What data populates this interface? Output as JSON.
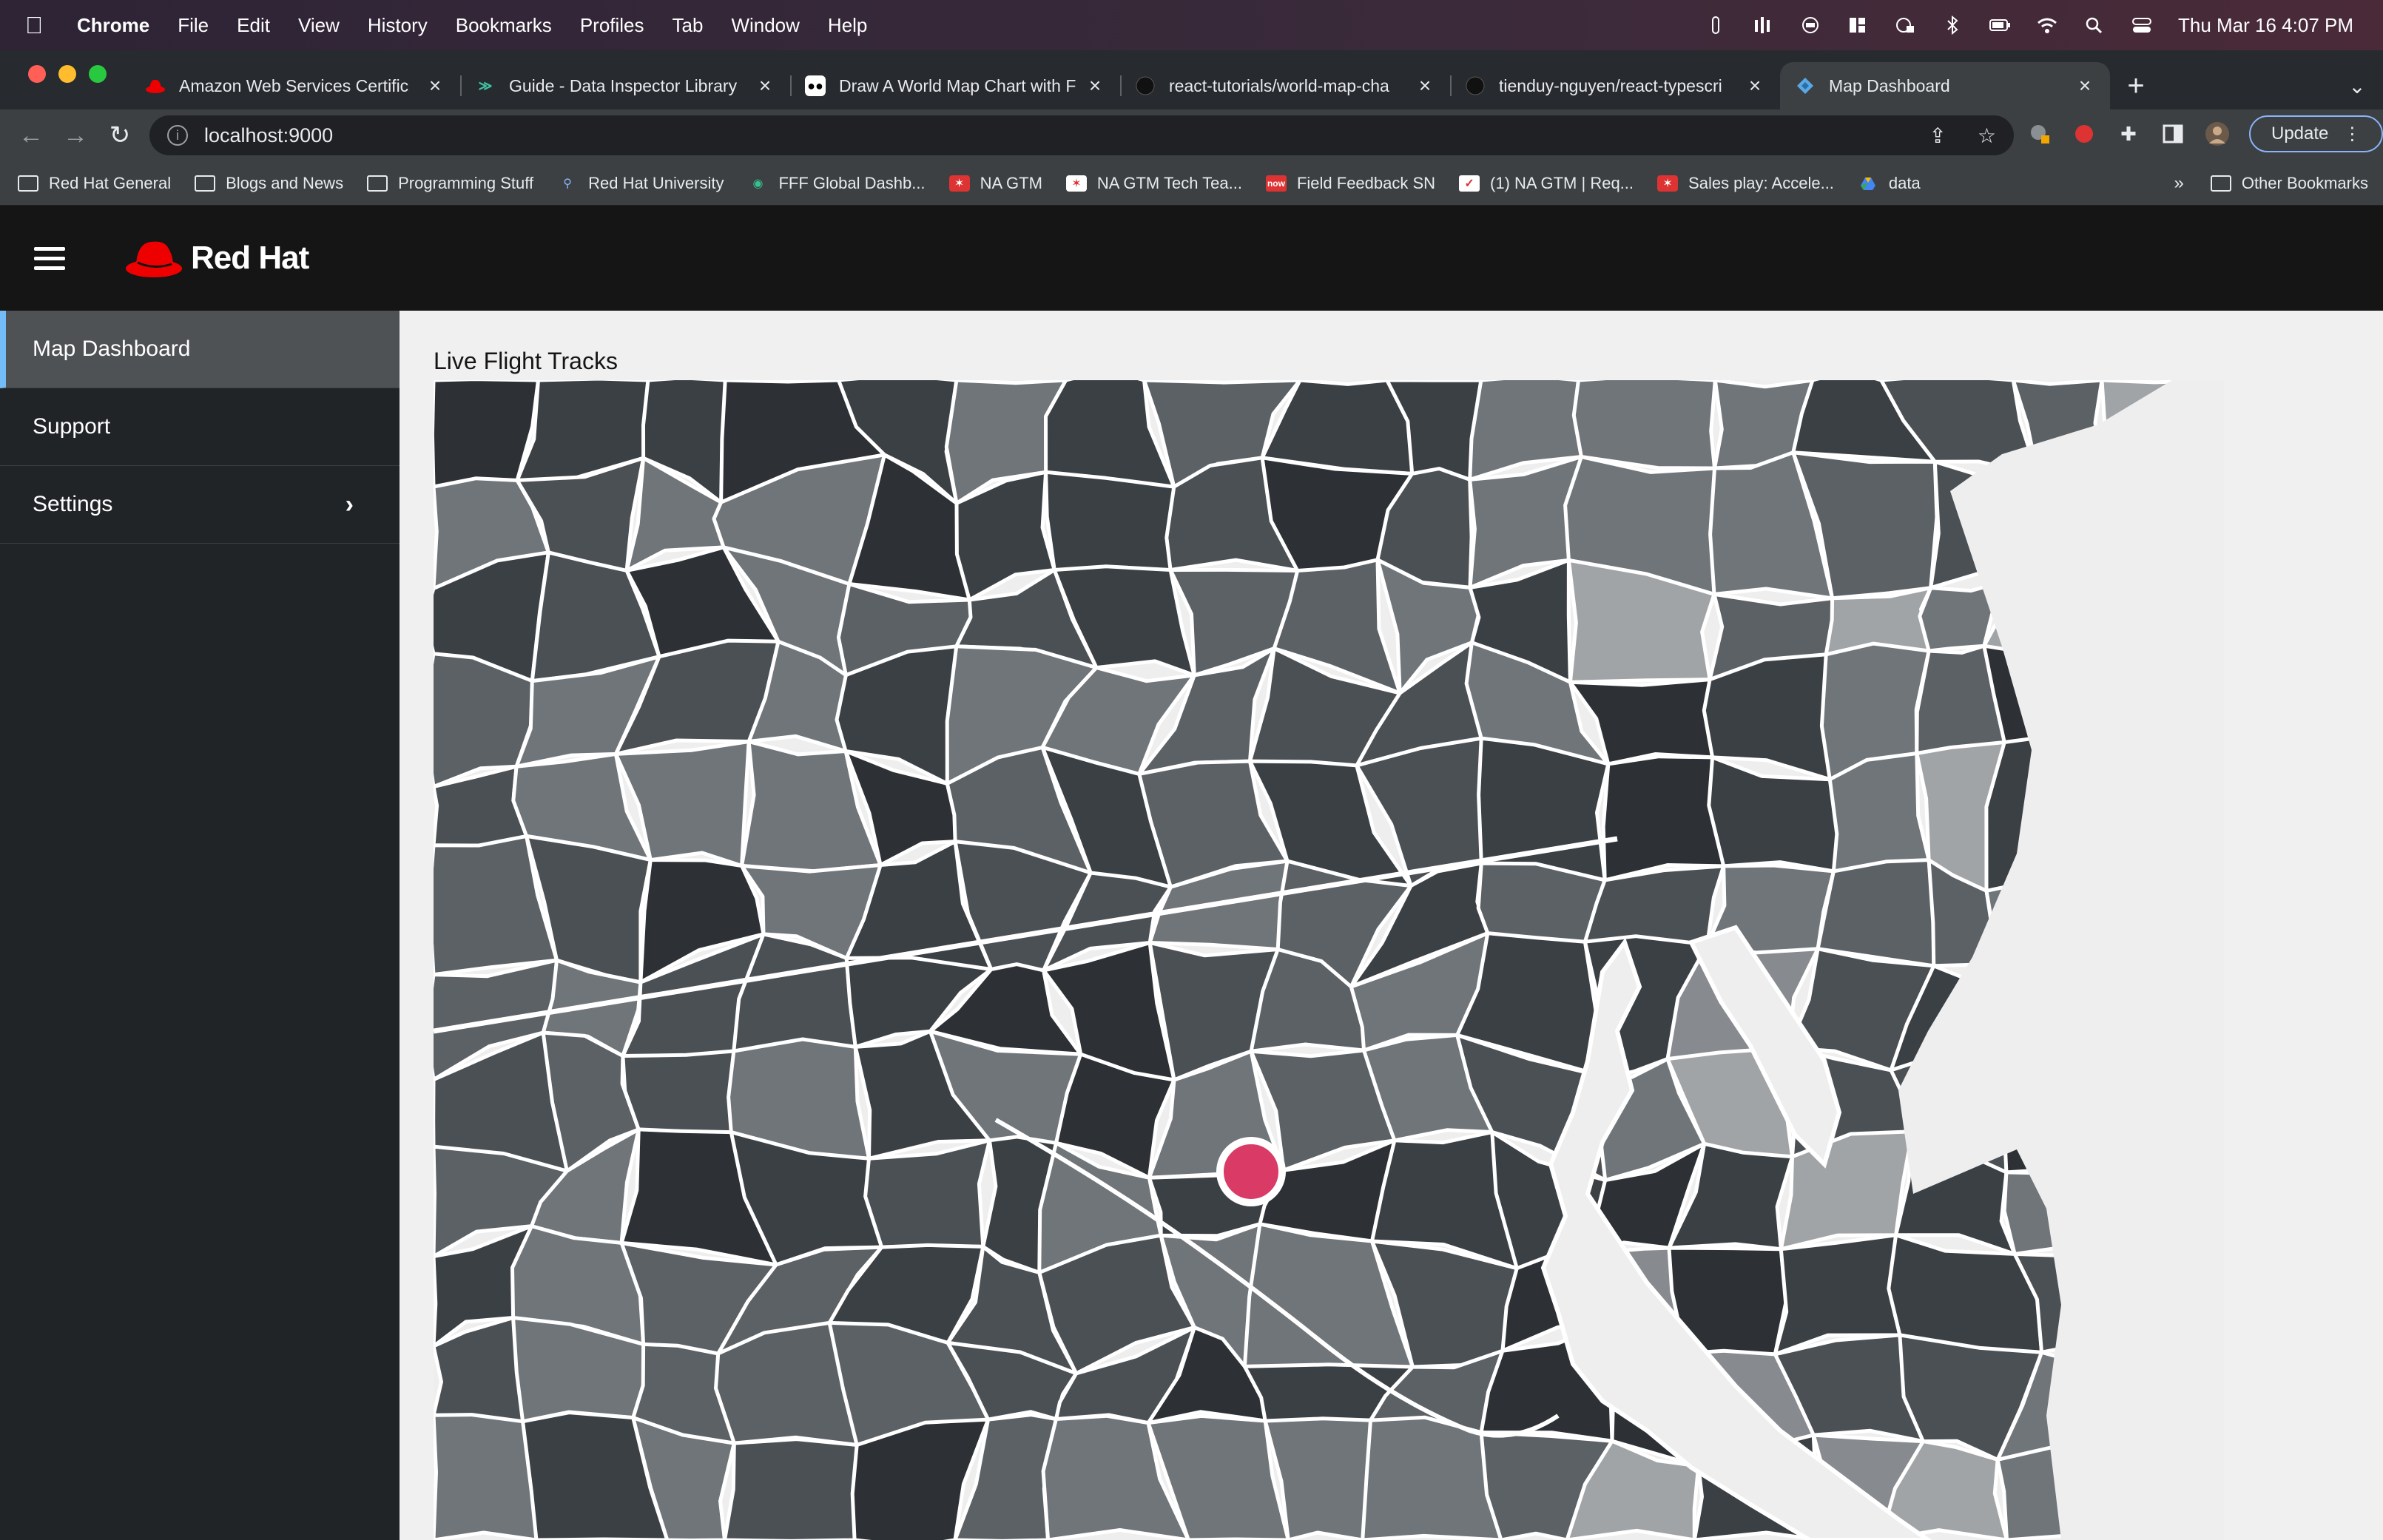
{
  "menubar": {
    "app": "Chrome",
    "items": [
      "File",
      "Edit",
      "View",
      "History",
      "Bookmarks",
      "Profiles",
      "Tab",
      "Window",
      "Help"
    ],
    "clock": "Thu Mar 16  4:07 PM"
  },
  "tabs": [
    {
      "title": "Amazon Web Services Certific",
      "favicon_color": "#e00"
    },
    {
      "title": "Guide - Data Inspector Library",
      "favicon_color": "#3ec1a2"
    },
    {
      "title": "Draw A World Map Chart with F",
      "favicon_color": "#000"
    },
    {
      "title": "react-tutorials/world-map-cha",
      "favicon_color": "#000"
    },
    {
      "title": "tienduy-nguyen/react-typescri",
      "favicon_color": "#000"
    },
    {
      "title": "Map Dashboard",
      "favicon_color": "#5aa9e6"
    }
  ],
  "address": {
    "url": "localhost:9000"
  },
  "toolbar": {
    "update_label": "Update"
  },
  "bookmarks": [
    {
      "label": "Red Hat General",
      "icon": "folder-icon"
    },
    {
      "label": "Blogs and News",
      "icon": "folder-icon"
    },
    {
      "label": "Programming Stuff",
      "icon": "folder-icon"
    },
    {
      "label": "Red Hat University",
      "icon": "pin-icon"
    },
    {
      "label": "FFF Global Dashb...",
      "icon": "circle-icon"
    },
    {
      "label": "NA GTM",
      "icon": "star-icon"
    },
    {
      "label": "NA GTM Tech Tea...",
      "icon": "star-icon"
    },
    {
      "label": "Field Feedback SN",
      "icon": "now-icon"
    },
    {
      "label": "(1) NA GTM | Req...",
      "icon": "check-icon"
    },
    {
      "label": "Sales play: Accele...",
      "icon": "star-icon"
    },
    {
      "label": "data",
      "icon": "drive-icon"
    }
  ],
  "bookmarks_other": "Other Bookmarks",
  "app": {
    "brand": "Red Hat",
    "sidebar": [
      {
        "label": "Map Dashboard",
        "active": true
      },
      {
        "label": "Support",
        "active": false
      },
      {
        "label": "Settings",
        "active": false,
        "expandable": true
      }
    ],
    "page_title": "Live Flight Tracks"
  },
  "map": {
    "marker_color": "#d93a66",
    "border_color": "#ffffff",
    "water_color": "#eeeeee",
    "fill_shades": [
      "#2d3135",
      "#3b4045",
      "#4b5055",
      "#5c6166",
      "#70757a",
      "#878b90",
      "#a1a4a7"
    ]
  }
}
